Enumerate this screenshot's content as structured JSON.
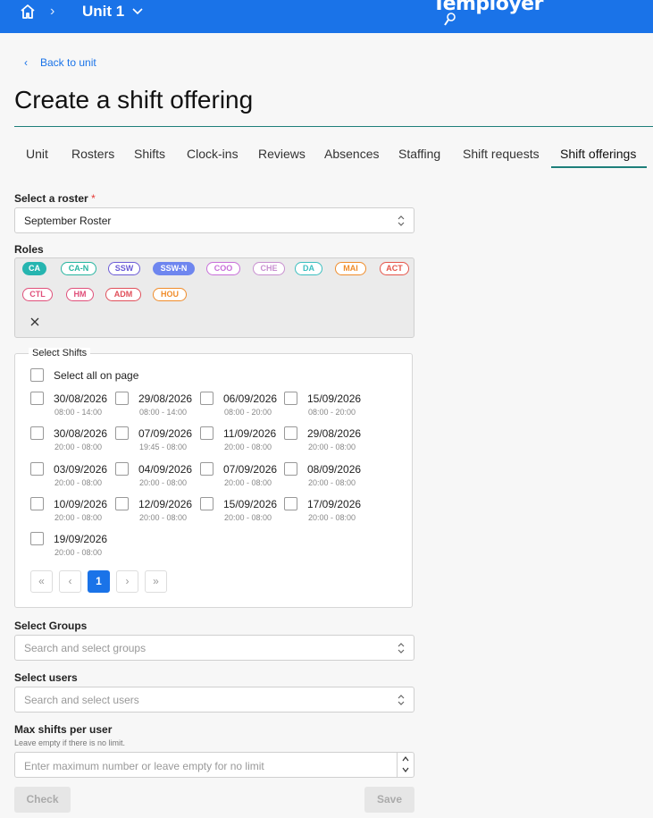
{
  "topbar": {
    "unit_label": "Unit 1",
    "brand": "Temployer",
    "brand_color": "#1a73e8"
  },
  "back_link": "Back to unit",
  "page_title": "Create a shift offering",
  "tabs": [
    "Unit",
    "Rosters",
    "Shifts",
    "Clock-ins",
    "Reviews",
    "Absences",
    "Staffing",
    "Shift requests",
    "Shift offerings"
  ],
  "active_tab": "Shift offerings",
  "roster": {
    "label": "Select a roster",
    "required_mark": "*",
    "value": "September Roster"
  },
  "roles": {
    "label": "Roles",
    "chips": [
      {
        "code": "CA",
        "color": "#26b5b0",
        "filled": true
      },
      {
        "code": "CA-N",
        "color": "#26b5a0",
        "filled": false
      },
      {
        "code": "SSW",
        "color": "#6b5bd6",
        "filled": false
      },
      {
        "code": "SSW-N",
        "color": "#6e86ef",
        "filled": true
      },
      {
        "code": "COO",
        "color": "#c86fd9",
        "filled": false
      },
      {
        "code": "CHE",
        "color": "#c88fd0",
        "filled": false
      },
      {
        "code": "DA",
        "color": "#3bbfc0",
        "filled": false
      },
      {
        "code": "MAI",
        "color": "#f08c2a",
        "filled": false
      },
      {
        "code": "ACT",
        "color": "#e5554a",
        "filled": false
      },
      {
        "code": "CTL",
        "color": "#e04f7a",
        "filled": false
      },
      {
        "code": "HM",
        "color": "#e04f7a",
        "filled": false
      },
      {
        "code": "ADM",
        "color": "#e04f5a",
        "filled": false
      },
      {
        "code": "HOU",
        "color": "#f08c2a",
        "filled": false
      }
    ]
  },
  "shifts": {
    "legend": "Select Shifts",
    "select_all_label": "Select all on page",
    "items": [
      {
        "date": "30/08/2026",
        "time": "08:00 - 14:00"
      },
      {
        "date": "29/08/2026",
        "time": "08:00 - 14:00"
      },
      {
        "date": "06/09/2026",
        "time": "08:00 - 20:00"
      },
      {
        "date": "15/09/2026",
        "time": "08:00 - 20:00"
      },
      {
        "date": "30/08/2026",
        "time": "20:00 - 08:00"
      },
      {
        "date": "07/09/2026",
        "time": "19:45 - 08:00"
      },
      {
        "date": "11/09/2026",
        "time": "20:00 - 08:00"
      },
      {
        "date": "29/08/2026",
        "time": "20:00 - 08:00"
      },
      {
        "date": "03/09/2026",
        "time": "20:00 - 08:00"
      },
      {
        "date": "04/09/2026",
        "time": "20:00 - 08:00"
      },
      {
        "date": "07/09/2026",
        "time": "20:00 - 08:00"
      },
      {
        "date": "08/09/2026",
        "time": "20:00 - 08:00"
      },
      {
        "date": "10/09/2026",
        "time": "20:00 - 08:00"
      },
      {
        "date": "12/09/2026",
        "time": "20:00 - 08:00"
      },
      {
        "date": "15/09/2026",
        "time": "20:00 - 08:00"
      },
      {
        "date": "17/09/2026",
        "time": "20:00 - 08:00"
      },
      {
        "date": "19/09/2026",
        "time": "20:00 - 08:00"
      }
    ],
    "pagination": {
      "first": "«",
      "prev": "‹",
      "current": "1",
      "next": "›",
      "last": "»"
    }
  },
  "groups": {
    "label": "Select Groups",
    "placeholder": "Search and select groups"
  },
  "users": {
    "label": "Select users",
    "placeholder": "Search and select users"
  },
  "max_shifts": {
    "label": "Max shifts per user",
    "hint": "Leave empty if there is no limit.",
    "placeholder": "Enter maximum number or leave empty for no limit"
  },
  "actions": {
    "check_label": "Check",
    "save_label": "Save"
  }
}
